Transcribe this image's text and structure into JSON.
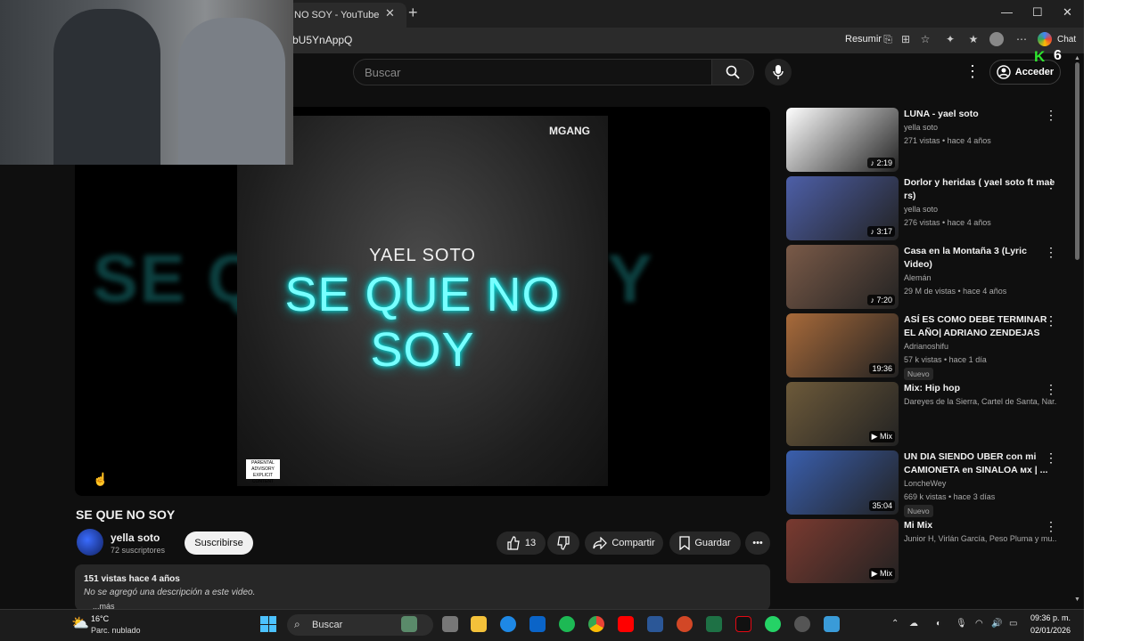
{
  "browser": {
    "tab_title": "NO SOY - YouTube",
    "tab_close": "✕",
    "new_tab": "+",
    "url": "bU5YnAppQ",
    "resumir": "Resumir",
    "chat": "Chat",
    "window_min": "—",
    "window_max": "☐",
    "window_close": "✕"
  },
  "overlay": {
    "k_logo": "K",
    "k_count": "6"
  },
  "youtube": {
    "search_placeholder": "Buscar",
    "signin": "Acceder"
  },
  "player": {
    "brand": "MGANG",
    "artist": "YAEL SOTO",
    "song_title": "SE QUE NO SOY",
    "blur_text": "SE QUE NO SOY",
    "advisory": "PARENTAL ADVISORY EXPLICIT CONTENT"
  },
  "video": {
    "title": "SE QUE NO SOY",
    "channel": "yella  soto",
    "subscribers": "72 suscriptores",
    "subscribe": "Suscribirse",
    "likes": "13",
    "share": "Compartir",
    "save": "Guardar",
    "views_date": "151 vistas  hace 4 años",
    "description": "No se agregó una descripción a este video.",
    "more": "...más"
  },
  "recommendations": [
    {
      "title": "LUNA - yael soto",
      "channel": "yella soto",
      "meta": "271 vistas • hace 4 años",
      "duration": "♪ 2:19",
      "thumb": "#ffffff",
      "badge": ""
    },
    {
      "title": "Dorlor y heridas ( yael soto ft mae rs)",
      "channel": "yella soto",
      "meta": "276 vistas • hace 4 años",
      "duration": "♪ 3:17",
      "thumb": "#4d5fa8",
      "badge": ""
    },
    {
      "title": "Casa en la Montaña 3 (Lyric Video)",
      "channel": "Alemán",
      "meta": "29 M de vistas • hace 4 años",
      "duration": "♪ 7:20",
      "thumb": "#7a5a48",
      "badge": ""
    },
    {
      "title": "ASÍ ES COMO DEBE TERMINAR EL AÑO| ADRIANO ZENDEJAS",
      "channel": "Adrianoshifu",
      "meta": "57 k vistas • hace 1 día",
      "duration": "19:36",
      "thumb": "#a86a3a",
      "badge": "Nuevo"
    },
    {
      "title": "Mix: Hip hop",
      "channel": "Dareyes de la Sierra, Cartel de Santa, Nar...",
      "meta": "",
      "duration": "▶ Mix",
      "thumb": "#6d5a3a",
      "badge": ""
    },
    {
      "title": "UN DIA SIENDO UBER con mi CAMIONETA en SINALOA ᴍx | ...",
      "channel": "LoncheWey",
      "meta": "669 k vistas • hace 3 días",
      "duration": "35:04",
      "thumb": "#3a5fae",
      "badge": "Nuevo"
    },
    {
      "title": "Mi Mix",
      "channel": "Junior H, Virlán García, Peso Pluma y mu...",
      "meta": "",
      "duration": "▶ Mix",
      "thumb": "#7a3a30",
      "badge": ""
    }
  ],
  "taskbar": {
    "temp": "16°C",
    "weather": "Parc. nublado",
    "search": "Buscar",
    "time": "09:36 p. m.",
    "date": "02/01/2026"
  }
}
